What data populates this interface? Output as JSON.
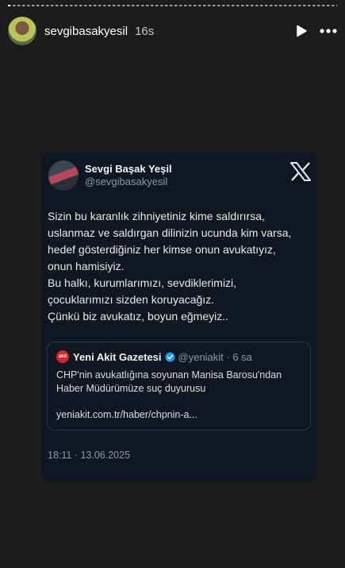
{
  "story": {
    "username": "sevgibasakyesil",
    "time_ago": "16s",
    "play_icon": "play-icon",
    "more_icon": "more-icon"
  },
  "tweet": {
    "author_name": "Sevgi Başak Yeşil",
    "author_handle": "@sevgibasakyesil",
    "platform_icon": "x-logo-icon",
    "text": "Sizin bu karanlık zihniyetiniz kime saldırırsa,\nuslanmaz ve saldırgan dilinizin ucunda kim varsa,\nhedef gösterdiğiniz her kimse onun avukatıyız,\nonun hamisiyiz.\nBu halkı, kurumlarımızı, sevdiklerimizi,\nçocuklarımızı sizden koruyacağız.\nÇünkü biz avukatız, boyun eğmeyiz..",
    "timestamp": "18:11 · 13.06.2025",
    "quoted": {
      "source_logo_text": "akit",
      "source_name": "Yeni Akit Gazetesi",
      "verified_icon": "verified-badge-icon",
      "meta": "@yeniakit · 6 sa",
      "text": "CHP'nin avukatlığına soyunan Manisa Barosu'ndan Haber Müdürümüze suç duyurusu",
      "link": "yeniakit.com.tr/haber/chpnin-a..."
    }
  },
  "colors": {
    "background": "#1c1c1c",
    "card": "#101722",
    "accent_verified": "#1d9bf0",
    "akit_red": "#d8242b"
  }
}
